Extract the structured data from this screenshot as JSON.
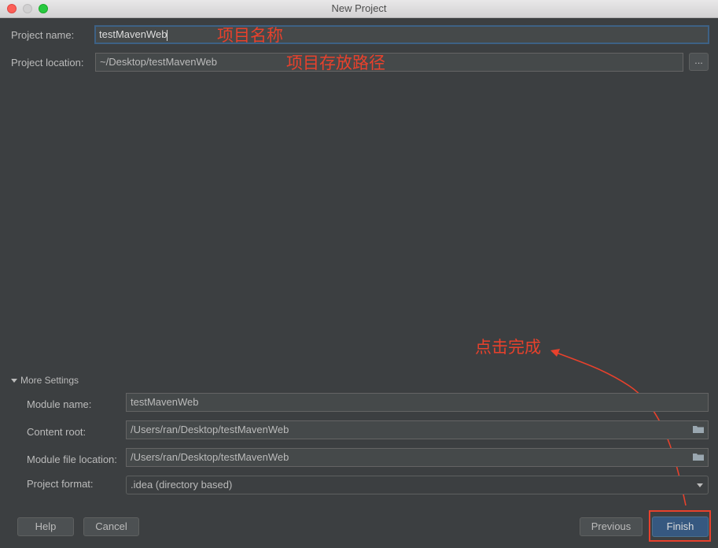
{
  "window": {
    "title": "New Project"
  },
  "project": {
    "name_label": "Project name:",
    "name_value": "testMavenWeb",
    "location_label": "Project location:",
    "location_value": "~/Desktop/testMavenWeb",
    "browse_label": "..."
  },
  "annotations": {
    "name_note": "项目名称",
    "location_note": "项目存放路径",
    "finish_note": "点击完成",
    "color": "#e8412c"
  },
  "more_settings": {
    "header": "More Settings",
    "module_name_label": "Module name:",
    "module_name_value": "testMavenWeb",
    "content_root_label": "Content root:",
    "content_root_value": "/Users/ran/Desktop/testMavenWeb",
    "module_file_label": "Module file location:",
    "module_file_value": "/Users/ran/Desktop/testMavenWeb",
    "format_label": "Project format:",
    "format_value": ".idea (directory based)"
  },
  "buttons": {
    "help": "Help",
    "cancel": "Cancel",
    "previous": "Previous",
    "finish": "Finish"
  },
  "icons": {
    "folder": "folder-icon",
    "dropdown": "chevron-down-icon",
    "collapse": "triangle-down-icon"
  }
}
